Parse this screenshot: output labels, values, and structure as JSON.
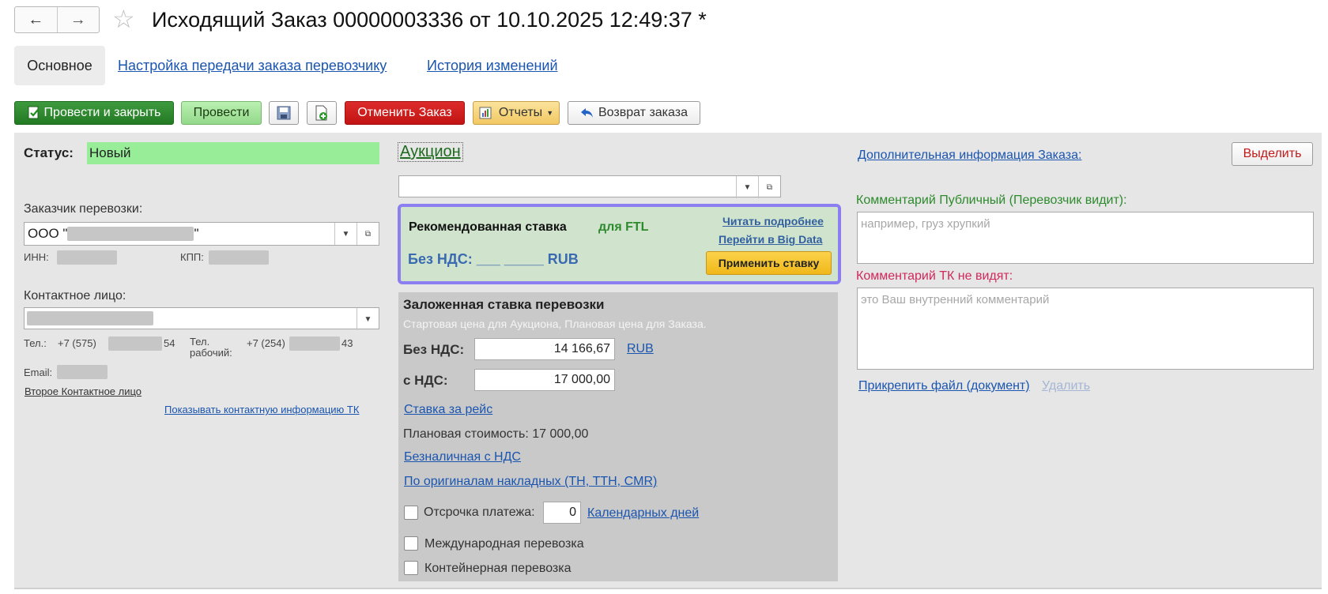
{
  "header": {
    "back_icon": "←",
    "forward_icon": "→",
    "favorite_icon": "☆",
    "title": "Исходящий Заказ 00000003336 от 10.10.2025 12:49:37 *"
  },
  "tabs": [
    {
      "label": "Основное"
    },
    {
      "label": "Настройка передачи заказа перевозчику"
    },
    {
      "label": "История изменений"
    }
  ],
  "toolbar": {
    "post_close": "Провести и закрыть",
    "post": "Провести",
    "cancel_order": "Отменить Заказ",
    "reports": "Отчеты",
    "return_order": "Возврат заказа"
  },
  "left": {
    "status_label": "Статус:",
    "status_value": "Новый",
    "customer_label": "Заказчик перевозки:",
    "customer_prefix": "ООО \"",
    "customer_suffix": "\"",
    "inn_label": "ИНН:",
    "kpp_label": "КПП:",
    "contact_label": "Контактное лицо:",
    "tel_label": "Тел.:",
    "tel_prefix": "+7 (575)",
    "tel_suffix": "54",
    "tel_work_label": "Тел. рабочий:",
    "tel_work_prefix": "+7 (254)",
    "tel_work_suffix": "43",
    "email_label": "Email:",
    "second_contact_link": "Второе Контактное лицо",
    "show_tk_contact_link": "Показывать контактную информацию ТК"
  },
  "middle": {
    "auction_link": "Аукцион",
    "recommended": {
      "title": "Рекомендованная ставка",
      "ftl": "для FTL",
      "read_more": "Читать подробнее",
      "big_data": "Перейти в Big Data",
      "no_vat": "Без НДС: ___ _____ RUB",
      "apply_button": "Применить ставку"
    },
    "planned_rate": {
      "title": "Заложенная ставка перевозки",
      "subtitle": "Стартовая цена для Аукциона, Плановая цена для Заказа.",
      "no_vat_label": "Без НДС:",
      "no_vat_value": "14 166,67",
      "currency": "RUB",
      "with_vat_label": "с НДС:",
      "with_vat_value": "17 000,00",
      "per_trip_link": "Ставка за рейс",
      "planned_cost": "Плановая стоимость: 17 000,00",
      "cashless_link": "Безналичная с НДС",
      "originals_link": "По оригиналам накладных (ТН, ТТН, CMR)",
      "deferral_label": "Отсрочка платежа:",
      "deferral_value": "0",
      "calendar_days_link": "Календарных дней",
      "international_label": "Международная перевозка",
      "container_label": "Контейнерная перевозка"
    }
  },
  "right": {
    "additional_info_link": "Дополнительная информация Заказа:",
    "highlight_button": "Выделить",
    "public_comment_label": "Комментарий Публичный (Перевозчик видит):",
    "public_comment_placeholder": "например, груз хрупкий",
    "internal_comment_label": "Комментарий ТК не видят:",
    "internal_comment_placeholder": "это Ваш внутренний комментарий",
    "attach_file_link": "Прикрепить файл (документ)",
    "delete_link": "Удалить"
  },
  "colors": {
    "status_bg": "#98ee98",
    "accent_link": "#1a55b0",
    "rec_border": "#8c7ef0",
    "public_label": "#2d8a2d",
    "internal_label": "#d0285a"
  }
}
